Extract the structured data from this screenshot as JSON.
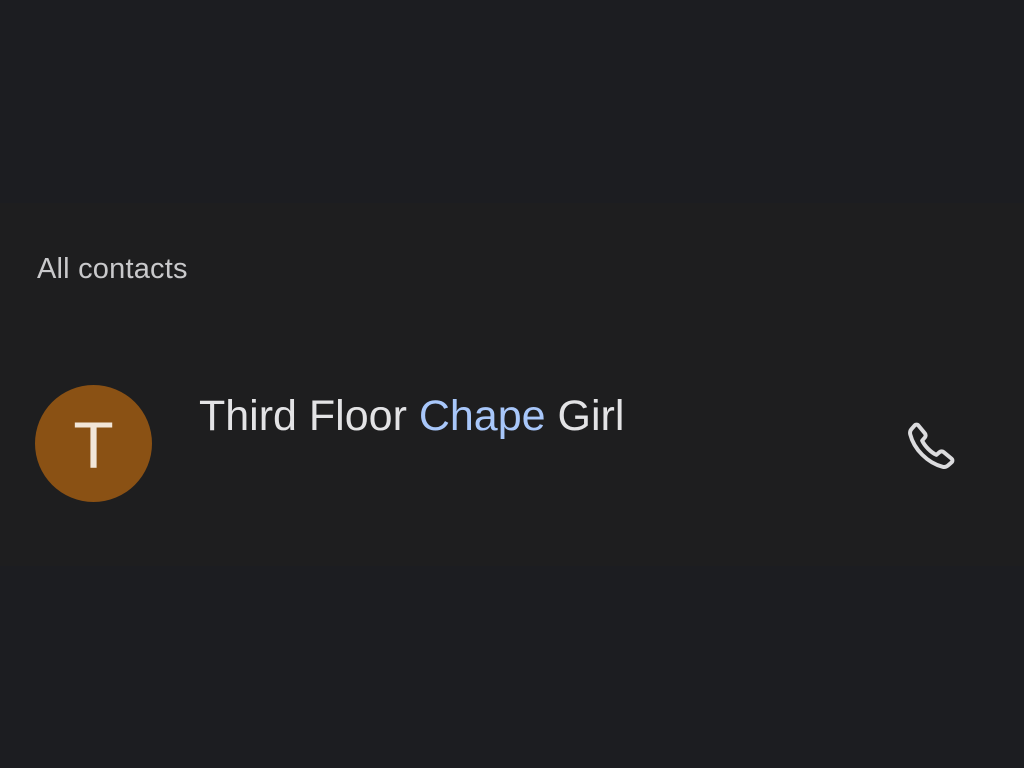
{
  "section": {
    "header": "All contacts"
  },
  "contacts": [
    {
      "avatar_letter": "T",
      "avatar_color": "#8a5114",
      "name_before": "Third Floor ",
      "name_match": "Chape",
      "name_after": " Girl",
      "action_icon": "phone-icon"
    }
  ],
  "colors": {
    "background": "#1c1d21",
    "panel": "#1e1e1f",
    "match_highlight": "#a8c7fa",
    "text_primary": "#e3e3e5",
    "text_secondary": "#c9c9cb"
  }
}
